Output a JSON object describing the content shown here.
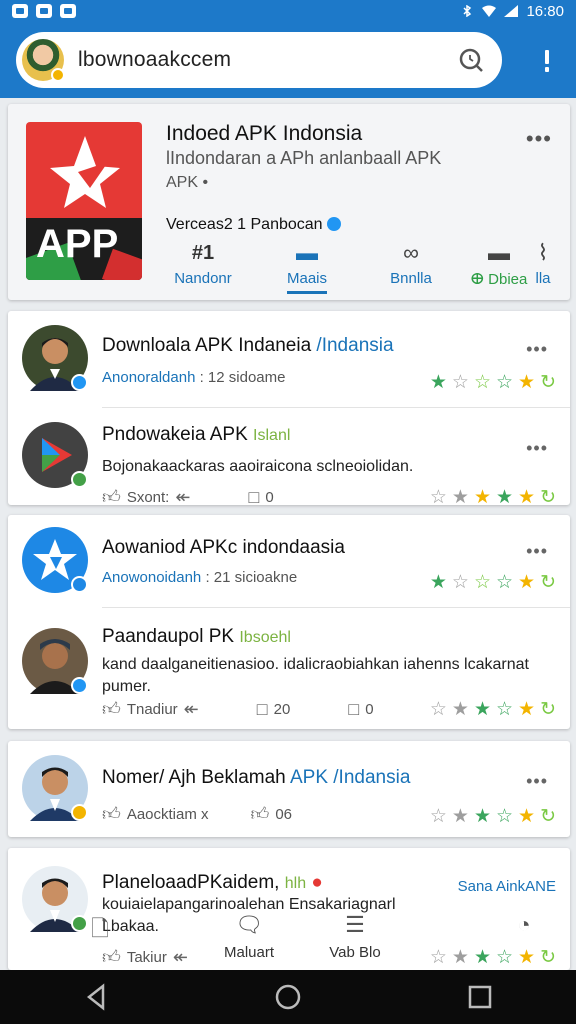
{
  "status_bar": {
    "time": "16:80"
  },
  "search": {
    "value": "lbownoaakccem"
  },
  "feature": {
    "title": "Indoed APK Indonsia",
    "subtitle": "lIndondaran a APh anlanbaall APK",
    "subtitle2": "APK •",
    "version": "Verceas2 1 Panbocan",
    "icon_label": "APP",
    "actions": [
      {
        "num": "#1",
        "label": "Nandonr"
      },
      {
        "label": "Maais"
      },
      {
        "label": "Bnnlla"
      },
      {
        "label": "Dbiea"
      },
      {
        "label": "lla"
      }
    ]
  },
  "feed": [
    {
      "title": "Downloala APK Indaneia",
      "title_link": " /Indansia",
      "sub_link": "Anonoraldanh",
      "sub": ": 12 sidoame"
    },
    {
      "title": "Pndowakeia APK",
      "title_tag": "Islanl",
      "body": "Bojonakaackaras aaoiraicona sclneoiolidan.",
      "meta_label": "Sxont:",
      "meta_count": "0"
    },
    {
      "title": "Aowaniod APKc indondaasia",
      "sub_link": "Anowonoidanh",
      "sub": ": 21 sicioakne"
    },
    {
      "title": "Paandaupol PK",
      "title_tag": "Ibsoehl",
      "body": "kand daalganeitienasioo. idalicraobiahkan iahenns lcakarnat pumer.",
      "meta_label": "Tnadiur",
      "meta_count1": "20",
      "meta_count2": "0"
    },
    {
      "title": "Nomer/ Ajh Beklamah",
      "title_link": " APK /Indansia",
      "meta_label": "Aaocktiam x",
      "meta_count": "06"
    },
    {
      "title": "PlaneloaadPKaidem,",
      "title_tag": "hlh",
      "right_badge": "Sana AinkANE",
      "body": "kouiaielapangarinoalehan Ensakariagnarl",
      "body2": "Lbakaa.",
      "meta_label": "Takiur"
    }
  ],
  "bottom_tabs": [
    {
      "label": "Maluart"
    },
    {
      "label": "Vab Blo"
    }
  ],
  "colors": {
    "primary": "#1d79c9",
    "accent": "#1a73b8",
    "star_yellow": "#f3b400",
    "star_green": "#3ba55d"
  }
}
